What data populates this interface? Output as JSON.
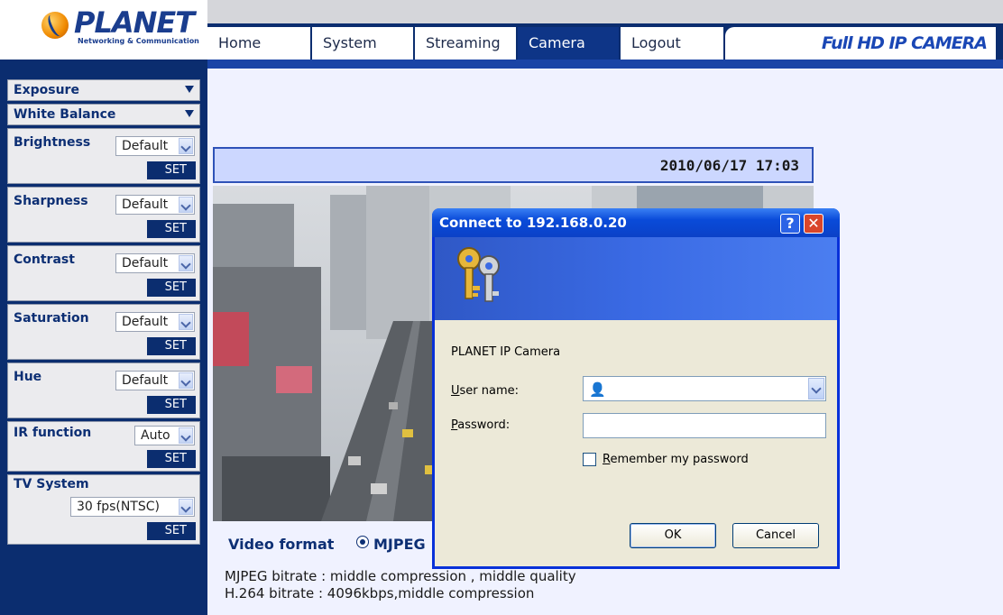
{
  "header": {
    "logo_text": "PLANET",
    "logo_tagline": "Networking & Communication",
    "tabs": [
      {
        "label": "Home",
        "active": false
      },
      {
        "label": "System",
        "active": false
      },
      {
        "label": "Streaming",
        "active": false
      },
      {
        "label": "Camera",
        "active": true
      },
      {
        "label": "Logout",
        "active": false
      }
    ],
    "product_title": "Full HD IP CAMERA"
  },
  "sidebar": {
    "exposure": "Exposure",
    "white_balance": "White Balance",
    "brightness": {
      "label": "Brightness",
      "value": "Default",
      "button": "SET"
    },
    "sharpness": {
      "label": "Sharpness",
      "value": "Default",
      "button": "SET"
    },
    "contrast": {
      "label": "Contrast",
      "value": "Default",
      "button": "SET"
    },
    "saturation": {
      "label": "Saturation",
      "value": "Default",
      "button": "SET"
    },
    "hue": {
      "label": "Hue",
      "value": "Default",
      "button": "SET"
    },
    "ir_function": {
      "label": "IR function",
      "value": "Auto",
      "button": "SET"
    },
    "tv_system": {
      "label": "TV System",
      "value": "30 fps(NTSC)",
      "button": "SET"
    }
  },
  "main": {
    "timestamp": "2010/06/17 17:03",
    "video_format_label": "Video format",
    "video_format_option": "MJPEG",
    "mjpeg_bitrate": "MJPEG bitrate : middle compression , middle quality",
    "h264_bitrate": "H.264 bitrate : 4096kbps,middle compression"
  },
  "dialog": {
    "title": "Connect to 192.168.0.20",
    "help_label": "?",
    "close_label": "✕",
    "site_name": "PLANET IP Camera",
    "username_label": "User name:",
    "username_value": "",
    "password_label": "Password:",
    "password_value": "",
    "remember_label": "Remember my password",
    "remember_checked": false,
    "ok_label": "OK",
    "cancel_label": "Cancel"
  },
  "colors": {
    "navy": "#0b2d6f",
    "active_tab": "#0e3587",
    "xp_title_blue": "#0a4bd9",
    "xp_face": "#ece9d8"
  }
}
